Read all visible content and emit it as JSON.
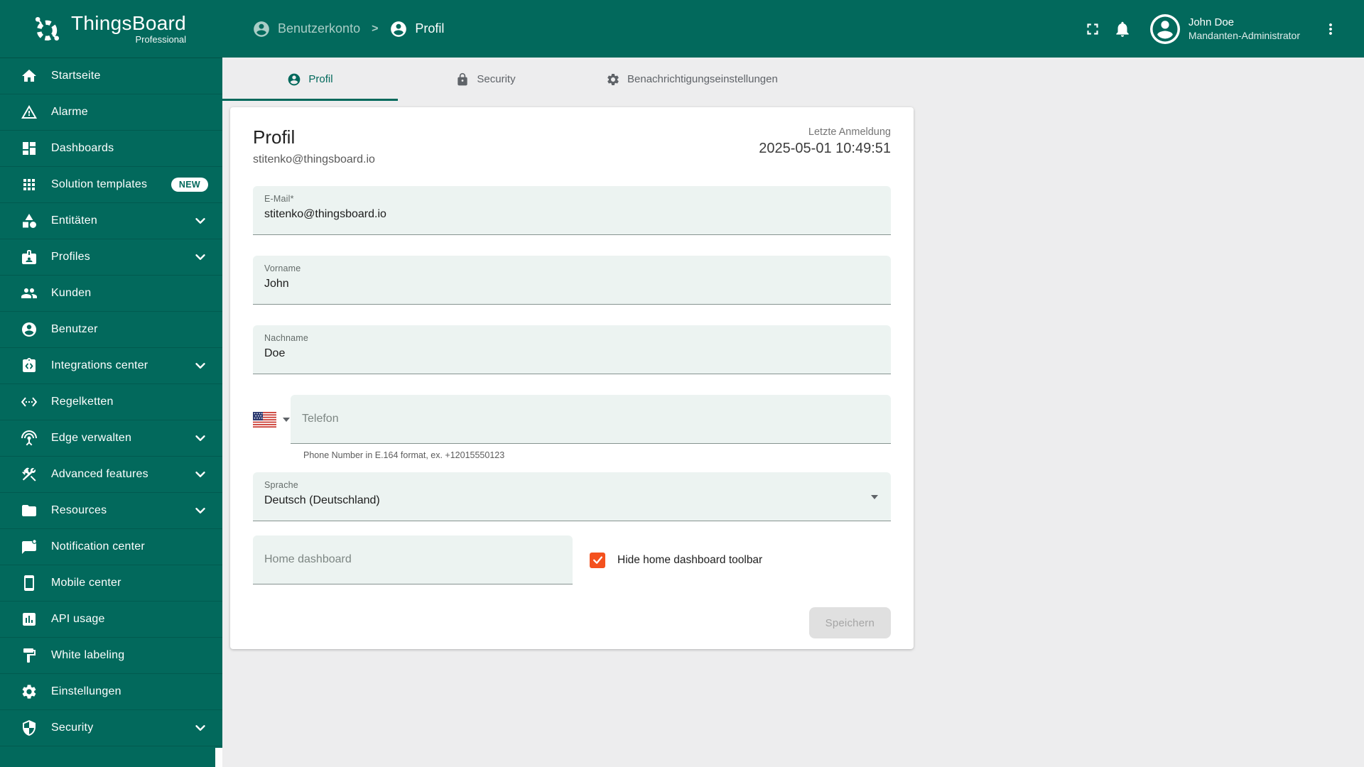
{
  "header": {
    "logo_title": "ThingsBoard",
    "logo_subtitle": "Professional",
    "breadcrumb": [
      {
        "label": "Benutzerkonto",
        "icon": "person-circle"
      },
      {
        "label": "Profil",
        "icon": "person-circle"
      }
    ],
    "breadcrumb_separator": ">",
    "icons": [
      "fullscreen-icon",
      "bell-icon",
      "avatar",
      "kebab-menu-icon"
    ],
    "user": {
      "name": "John Doe",
      "role": "Mandanten-Administrator"
    }
  },
  "sidebar": {
    "items": [
      {
        "label": "Startseite",
        "icon": "home"
      },
      {
        "label": "Alarme",
        "icon": "warning-triangle"
      },
      {
        "label": "Dashboards",
        "icon": "dashboard"
      },
      {
        "label": "Solution templates",
        "icon": "apps-grid",
        "badge": "NEW"
      },
      {
        "label": "Entitäten",
        "icon": "category-shapes",
        "expandable": true
      },
      {
        "label": "Profiles",
        "icon": "id-badge",
        "expandable": true
      },
      {
        "label": "Kunden",
        "icon": "people"
      },
      {
        "label": "Benutzer",
        "icon": "person-circle"
      },
      {
        "label": "Integrations center",
        "icon": "integration-board",
        "expandable": true
      },
      {
        "label": "Regelketten",
        "icon": "ethernet-code"
      },
      {
        "label": "Edge verwalten",
        "icon": "antenna",
        "expandable": true
      },
      {
        "label": "Advanced features",
        "icon": "tools",
        "expandable": true
      },
      {
        "label": "Resources",
        "icon": "folder",
        "expandable": true
      },
      {
        "label": "Notification center",
        "icon": "message-dot"
      },
      {
        "label": "Mobile center",
        "icon": "smartphone"
      },
      {
        "label": "API usage",
        "icon": "bar-chart-box"
      },
      {
        "label": "White labeling",
        "icon": "paint-roller"
      },
      {
        "label": "Einstellungen",
        "icon": "gear"
      },
      {
        "label": "Security",
        "icon": "shield",
        "expandable": true
      }
    ]
  },
  "tabs": [
    {
      "label": "Profil",
      "icon": "person-circle",
      "active": true
    },
    {
      "label": "Security",
      "icon": "lock",
      "active": false
    },
    {
      "label": "Benachrichtigungseinstellungen",
      "icon": "gear",
      "active": false
    }
  ],
  "profile_card": {
    "title": "Profil",
    "subtitle": "stitenko@thingsboard.io",
    "last_login_label": "Letzte Anmeldung",
    "last_login_value": "2025-05-01 10:49:51",
    "fields": {
      "email": {
        "label": "E-Mail*",
        "value": "stitenko@thingsboard.io"
      },
      "first_name": {
        "label": "Vorname",
        "value": "John"
      },
      "last_name": {
        "label": "Nachname",
        "value": "Doe"
      },
      "phone": {
        "placeholder": "Telefon",
        "country": "US",
        "hint": "Phone Number in E.164 format, ex. +12015550123"
      },
      "language": {
        "label": "Sprache",
        "value": "Deutsch (Deutschland)"
      },
      "home_dashboard": {
        "placeholder": "Home dashboard"
      },
      "hide_toolbar": {
        "label": "Hide home dashboard toolbar",
        "checked": true
      }
    },
    "save_button": {
      "label": "Speichern",
      "disabled": true
    }
  },
  "colors": {
    "primary": "#02695c",
    "content_bg": "#ededee",
    "card_bg": "#ffffff",
    "field_bg": "#ecf3f1",
    "checkbox_accent": "#f4511e",
    "badge_bg": "#ffffff",
    "badge_text": "#02695c",
    "tab_inactive": "#5f6368",
    "disabled_button_bg": "#e0e0e0",
    "disabled_button_text": "#a5a5a5"
  }
}
